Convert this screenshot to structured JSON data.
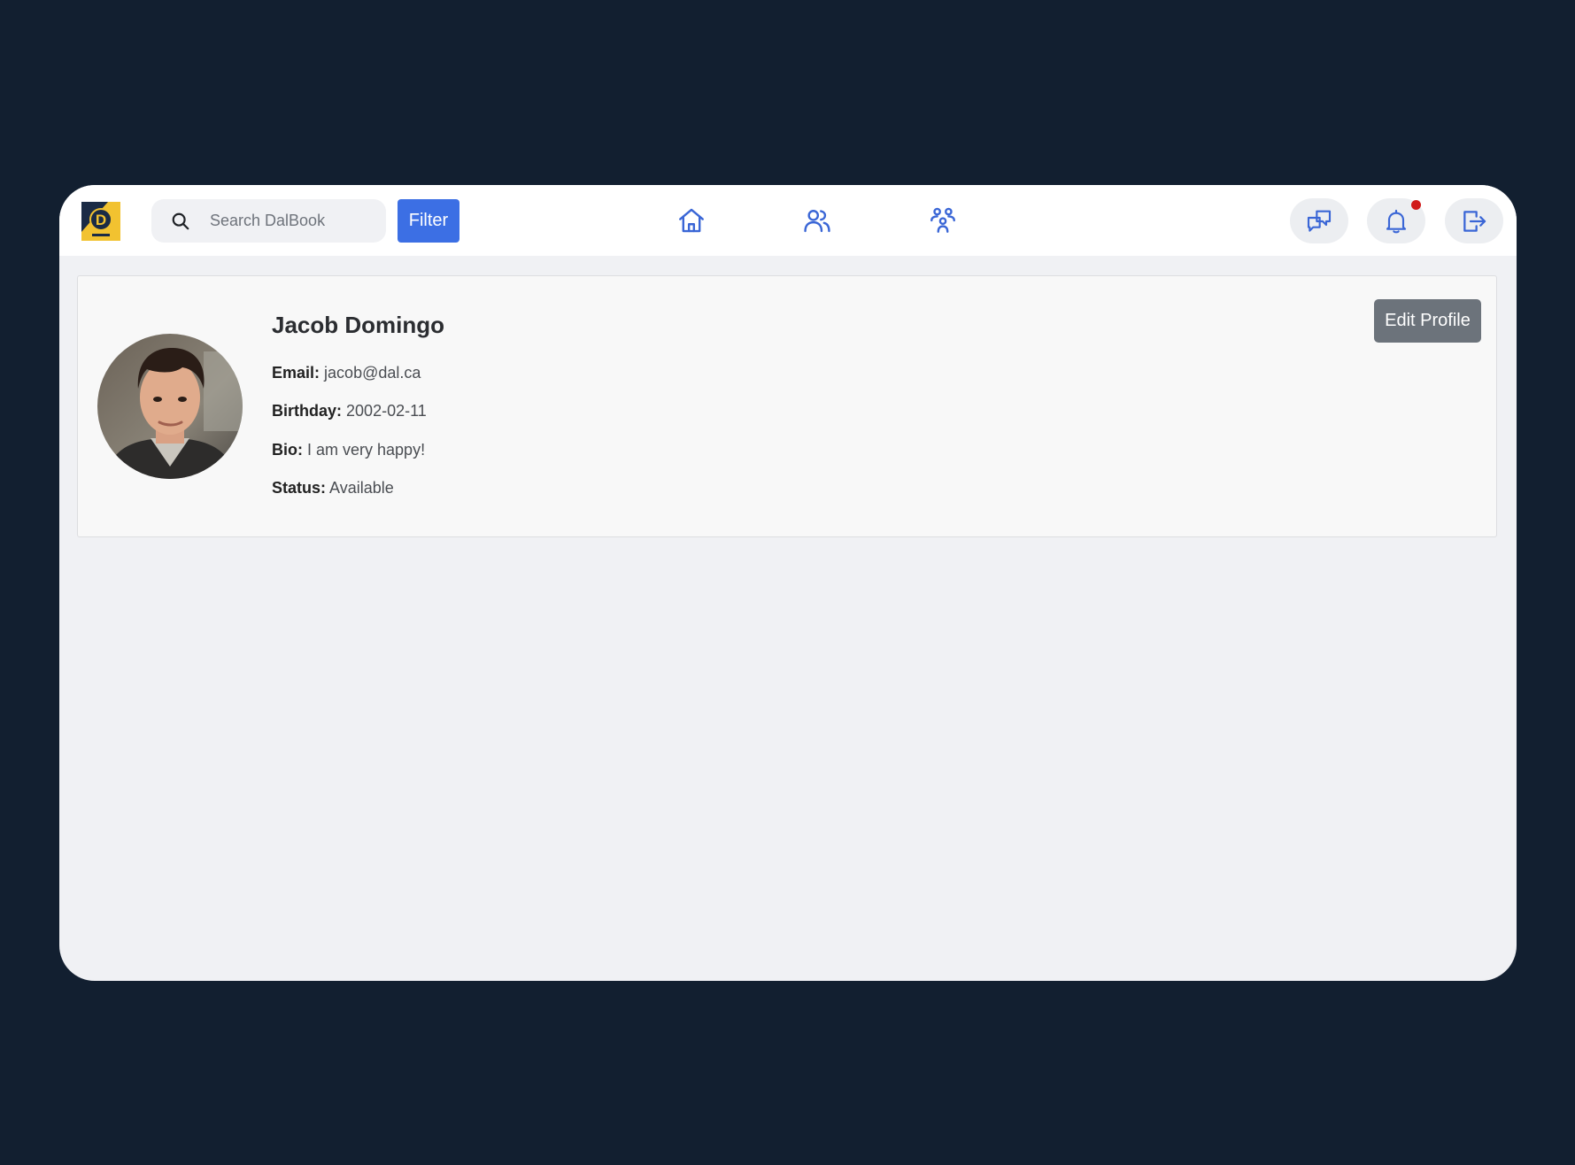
{
  "header": {
    "search": {
      "placeholder": "Search DalBook",
      "value": ""
    },
    "filter_label": "Filter",
    "nav": [
      "home-icon",
      "friends-icon",
      "groups-icon"
    ],
    "actions": [
      "messages-icon",
      "notifications-icon",
      "logout-icon"
    ],
    "notification_badge": true
  },
  "profile": {
    "name": "Jacob Domingo",
    "email_label": "Email:",
    "email": "jacob@dal.ca",
    "birthday_label": "Birthday:",
    "birthday": "2002-02-11",
    "bio_label": "Bio:",
    "bio": "I am very happy!",
    "status_label": "Status:",
    "status": "Available",
    "edit_label": "Edit Profile"
  },
  "colors": {
    "backdrop": "#121f30",
    "accent": "#3c6fe4",
    "icon": "#3a66d6",
    "edit_button": "#6c737b",
    "notification_dot": "#d01a1a"
  }
}
